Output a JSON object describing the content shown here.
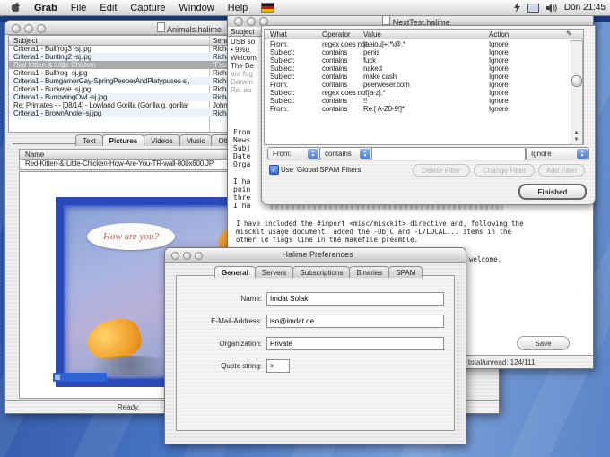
{
  "menu_bar": {
    "app_name": "Grab",
    "items": [
      "File",
      "Edit",
      "Capture",
      "Window",
      "Help"
    ],
    "clock": "Don 21:45"
  },
  "animals_window": {
    "title": "Animals.halime",
    "columns": {
      "subject": "Subject",
      "sender": "Sender"
    },
    "rows": [
      {
        "subject": "Criteria1 - Bullfrog3 -sj.jpg",
        "sender": "Richardson <sprith"
      },
      {
        "subject": "Criteria1 - Bunting2 -sj.jpg",
        "sender": "Richardson <sprith"
      },
      {
        "subject": "Red-Kitten-&-Little-Chicken",
        "sender": "\"Fradai\" <challenge"
      },
      {
        "subject": "Criteria1 - Bullfrog -sj.jpg",
        "sender": "Richardson <sprith"
      },
      {
        "subject": "Criteria1 - BumgarnerGay-SpringPeeperAndPlatypuses-sj,",
        "sender": "Richardson <sprith"
      },
      {
        "subject": "Criteria1 - Buckeye -sj.jpg",
        "sender": "Richardson <sprith"
      },
      {
        "subject": "Criteria1 - BurrowingOwl -sj.jpg",
        "sender": "Richardson <sprith"
      },
      {
        "subject": "Re: Primates - - [08/14] - Lowland Gorilla (Gorilla g. gorillar",
        "sender": "John White <ragni"
      },
      {
        "subject": "Criteria1 - BrownAnole -sj.jpg",
        "sender": "Richardson <sprith"
      }
    ],
    "tabs": [
      "Text",
      "Pictures",
      "Videos",
      "Music",
      "Other/Al"
    ],
    "selected_tab": "Pictures",
    "name_column": "Name",
    "filename": "Red-Kitten-&-Little-Chicken-How-Are-You-TR-wall-800x600.JP",
    "speech_bubble": "How are you?",
    "status": "Ready."
  },
  "reader_window": {
    "title": "NextTest.halime",
    "strip": {
      "header": "Subject",
      "rows": [
        "USB so",
        "• 9%u",
        "Welcom",
        "The Be",
        "aur fug",
        "Darwin",
        "Re: au"
      ]
    },
    "header_fragments": [
      "From",
      "News",
      "Subj",
      "Date",
      "Orga"
    ],
    "body_fragments": [
      "I ha",
      "poin",
      "thre",
      "I ha"
    ],
    "body_lines": [
      "I have included the #import <misc/misckit> directive and, following the",
      "misckit usage document, added the -ObjC and -L/LOCAL... items in the",
      "other ld flags line in the makefile preamble."
    ],
    "welcome_text": "welcome.",
    "save_button": "Save",
    "status": "total/unread: 124/111"
  },
  "filter_panel": {
    "columns": [
      "What",
      "Operator",
      "Value",
      "Action"
    ],
    "rules": [
      {
        "what": "From:",
        "op": "regex does not",
        "value": "[aeiou]+.*\\@.*",
        "action": "Ignore"
      },
      {
        "what": "Subject:",
        "op": "contains",
        "value": "penis",
        "action": "Ignore"
      },
      {
        "what": "Subject:",
        "op": "contains",
        "value": "fuck",
        "action": "Ignore"
      },
      {
        "what": "Subject:",
        "op": "contains",
        "value": "naked",
        "action": "Ignore"
      },
      {
        "what": "Subject:",
        "op": "contains",
        "value": "make cash",
        "action": "Ignore"
      },
      {
        "what": "From:",
        "op": "contains",
        "value": "peerweser.com",
        "action": "Ignore"
      },
      {
        "what": "Subject:",
        "op": "regex does not",
        "value": ".*[a-z].*",
        "action": "Ignore"
      },
      {
        "what": "Subject:",
        "op": "contains",
        "value": "!!",
        "action": "Ignore"
      },
      {
        "what": "From:",
        "op": "contains",
        "value": "Re:[ A-Z0-9!]*",
        "action": "Ignore"
      }
    ],
    "what_popup": "From:",
    "operator_popup": "contains",
    "value_field": "",
    "action_popup": "Ignore",
    "checkbox_label": "Use 'Global SPAM Filters'",
    "buttons": {
      "delete": "Delete Filter",
      "change": "Change Filter",
      "add": "Add Filter",
      "finished": "Finished"
    }
  },
  "preferences_window": {
    "title": "Halime Preferences",
    "tabs": [
      "General",
      "Servers",
      "Subscriptions",
      "Binaries",
      "SPAM"
    ],
    "selected_tab": "General",
    "fields": [
      {
        "label": "Name:",
        "value": "Imdat Solak"
      },
      {
        "label": "E-Mail-Address:",
        "value": "iso@imdat.de"
      },
      {
        "label": "Organization:",
        "value": "Private"
      },
      {
        "label": "Quote string:",
        "value": ">"
      }
    ]
  },
  "colors": {
    "desktop": "#4a77c0",
    "selection_blue": "#2d63d6",
    "popup_blue": "#5c8ae6"
  }
}
